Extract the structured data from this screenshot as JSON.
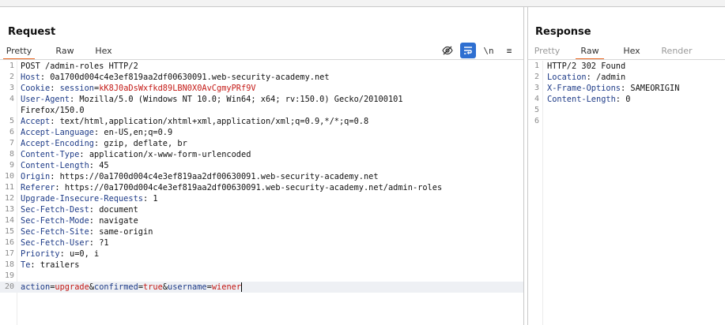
{
  "request": {
    "title": "Request",
    "tabs": [
      {
        "label": "Pretty",
        "active": true
      },
      {
        "label": "Raw",
        "active": false
      },
      {
        "label": "Hex",
        "active": false
      }
    ],
    "tools": [
      {
        "icon": "eye-slash-icon",
        "label": ""
      },
      {
        "icon": "word-wrap-icon",
        "label": ""
      },
      {
        "icon": "newline-toggle-icon",
        "label": "\\n"
      },
      {
        "icon": "menu-icon",
        "label": "≡"
      }
    ],
    "lines": [
      {
        "n": "1",
        "parts": [
          {
            "t": "POST /admin-roles HTTP/2",
            "c": "hv"
          }
        ]
      },
      {
        "n": "2",
        "parts": [
          {
            "t": "Host",
            "c": "hk"
          },
          {
            "t": ": ",
            "c": "sep"
          },
          {
            "t": "0a1700d004c4e3ef819aa2df00630091.web-security-academy.net",
            "c": "hv"
          }
        ]
      },
      {
        "n": "3",
        "parts": [
          {
            "t": "Cookie",
            "c": "hk"
          },
          {
            "t": ": ",
            "c": "sep"
          },
          {
            "t": "session",
            "c": "hk"
          },
          {
            "t": "=",
            "c": "sep"
          },
          {
            "t": "kK8J0aDsWxfkd89LBN0X0AvCgmyPRf9V",
            "c": "cv"
          }
        ]
      },
      {
        "n": "4",
        "parts": [
          {
            "t": "User-Agent",
            "c": "hk"
          },
          {
            "t": ": ",
            "c": "sep"
          },
          {
            "t": "Mozilla/5.0 (Windows NT 10.0; Win64; x64; rv:150.0) Gecko/20100101",
            "c": "hv"
          }
        ]
      },
      {
        "n": "",
        "parts": [
          {
            "t": "Firefox/150.0",
            "c": "hv"
          }
        ]
      },
      {
        "n": "5",
        "parts": [
          {
            "t": "Accept",
            "c": "hk"
          },
          {
            "t": ": ",
            "c": "sep"
          },
          {
            "t": "text/html,application/xhtml+xml,application/xml;q=0.9,*/*;q=0.8",
            "c": "hv"
          }
        ]
      },
      {
        "n": "6",
        "parts": [
          {
            "t": "Accept-Language",
            "c": "hk"
          },
          {
            "t": ": ",
            "c": "sep"
          },
          {
            "t": "en-US,en;q=0.9",
            "c": "hv"
          }
        ]
      },
      {
        "n": "7",
        "parts": [
          {
            "t": "Accept-Encoding",
            "c": "hk"
          },
          {
            "t": ": ",
            "c": "sep"
          },
          {
            "t": "gzip, deflate, br",
            "c": "hv"
          }
        ]
      },
      {
        "n": "8",
        "parts": [
          {
            "t": "Content-Type",
            "c": "hk"
          },
          {
            "t": ": ",
            "c": "sep"
          },
          {
            "t": "application/x-www-form-urlencoded",
            "c": "hv"
          }
        ]
      },
      {
        "n": "9",
        "parts": [
          {
            "t": "Content-Length",
            "c": "hk"
          },
          {
            "t": ": ",
            "c": "sep"
          },
          {
            "t": "45",
            "c": "hv"
          }
        ]
      },
      {
        "n": "10",
        "parts": [
          {
            "t": "Origin",
            "c": "hk"
          },
          {
            "t": ": ",
            "c": "sep"
          },
          {
            "t": "https://0a1700d004c4e3ef819aa2df00630091.web-security-academy.net",
            "c": "hv"
          }
        ]
      },
      {
        "n": "11",
        "parts": [
          {
            "t": "Referer",
            "c": "hk"
          },
          {
            "t": ": ",
            "c": "sep"
          },
          {
            "t": "https://0a1700d004c4e3ef819aa2df00630091.web-security-academy.net/admin-roles",
            "c": "hv"
          }
        ]
      },
      {
        "n": "12",
        "parts": [
          {
            "t": "Upgrade-Insecure-Requests",
            "c": "hk"
          },
          {
            "t": ": ",
            "c": "sep"
          },
          {
            "t": "1",
            "c": "hv"
          }
        ]
      },
      {
        "n": "13",
        "parts": [
          {
            "t": "Sec-Fetch-Dest",
            "c": "hk"
          },
          {
            "t": ": ",
            "c": "sep"
          },
          {
            "t": "document",
            "c": "hv"
          }
        ]
      },
      {
        "n": "14",
        "parts": [
          {
            "t": "Sec-Fetch-Mode",
            "c": "hk"
          },
          {
            "t": ": ",
            "c": "sep"
          },
          {
            "t": "navigate",
            "c": "hv"
          }
        ]
      },
      {
        "n": "15",
        "parts": [
          {
            "t": "Sec-Fetch-Site",
            "c": "hk"
          },
          {
            "t": ": ",
            "c": "sep"
          },
          {
            "t": "same-origin",
            "c": "hv"
          }
        ]
      },
      {
        "n": "16",
        "parts": [
          {
            "t": "Sec-Fetch-User",
            "c": "hk"
          },
          {
            "t": ": ",
            "c": "sep"
          },
          {
            "t": "?1",
            "c": "hv"
          }
        ]
      },
      {
        "n": "17",
        "parts": [
          {
            "t": "Priority",
            "c": "hk"
          },
          {
            "t": ": ",
            "c": "sep"
          },
          {
            "t": "u=0, i",
            "c": "hv"
          }
        ]
      },
      {
        "n": "18",
        "parts": [
          {
            "t": "Te",
            "c": "hk"
          },
          {
            "t": ": ",
            "c": "sep"
          },
          {
            "t": "trailers",
            "c": "hv"
          }
        ]
      },
      {
        "n": "19",
        "parts": []
      },
      {
        "n": "20",
        "current": true,
        "parts": [
          {
            "t": "action",
            "c": "pn"
          },
          {
            "t": "=",
            "c": "sep"
          },
          {
            "t": "upgrade",
            "c": "pv"
          },
          {
            "t": "&",
            "c": "sep"
          },
          {
            "t": "confirmed",
            "c": "pn"
          },
          {
            "t": "=",
            "c": "sep"
          },
          {
            "t": "true",
            "c": "pv"
          },
          {
            "t": "&",
            "c": "sep"
          },
          {
            "t": "username",
            "c": "pn"
          },
          {
            "t": "=",
            "c": "sep"
          },
          {
            "t": "wiener",
            "c": "pv"
          }
        ]
      }
    ]
  },
  "response": {
    "title": "Response",
    "tabs": [
      {
        "label": "Pretty",
        "active": false,
        "disabled": true
      },
      {
        "label": "Raw",
        "active": true
      },
      {
        "label": "Hex",
        "active": false
      },
      {
        "label": "Render",
        "active": false,
        "disabled": true
      }
    ],
    "lines": [
      {
        "n": "1",
        "parts": [
          {
            "t": "HTTP/2 302 Found",
            "c": "hv"
          }
        ]
      },
      {
        "n": "2",
        "parts": [
          {
            "t": "Location",
            "c": "hk"
          },
          {
            "t": ": ",
            "c": "sep"
          },
          {
            "t": "/admin",
            "c": "hv"
          }
        ]
      },
      {
        "n": "3",
        "parts": [
          {
            "t": "X-Frame-Options",
            "c": "hk"
          },
          {
            "t": ": ",
            "c": "sep"
          },
          {
            "t": "SAMEORIGIN",
            "c": "hv"
          }
        ]
      },
      {
        "n": "4",
        "parts": [
          {
            "t": "Content-Length",
            "c": "hk"
          },
          {
            "t": ": ",
            "c": "sep"
          },
          {
            "t": "0",
            "c": "hv"
          }
        ]
      },
      {
        "n": "5",
        "parts": []
      },
      {
        "n": "6",
        "parts": []
      }
    ]
  },
  "colors": {
    "accent": "#e8621a",
    "header_key": "#1f3c88",
    "value_red": "#c41a16",
    "toggle_on": "#2e6fd1"
  }
}
